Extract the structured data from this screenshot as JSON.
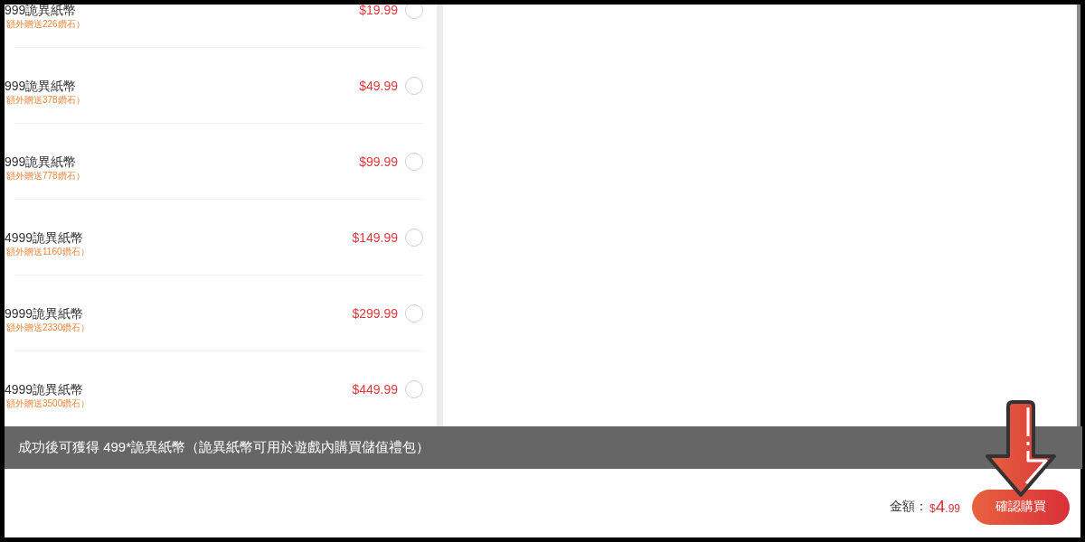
{
  "packages": [
    {
      "title": "999詭異紙幣",
      "bonus": "額外贈送226鑽石）",
      "price": "$19.99",
      "selected": false
    },
    {
      "title": "999詭異紙幣",
      "bonus": "額外贈送378鑽石）",
      "price": "$49.99",
      "selected": false
    },
    {
      "title": "999詭異紙幣",
      "bonus": "額外贈送778鑽石）",
      "price": "$99.99",
      "selected": false
    },
    {
      "title": "4999詭異紙幣",
      "bonus": "額外贈送1160鑽石）",
      "price": "$149.99",
      "selected": false
    },
    {
      "title": "9999詭異紙幣",
      "bonus": "額外贈送2330鑽石）",
      "price": "$299.99",
      "selected": false
    },
    {
      "title": "4999詭異紙幣",
      "bonus": "額外贈送3500鑽石）",
      "price": "$449.99",
      "selected": false
    }
  ],
  "notice": "成功後可獲得 499*詭異紙幣（詭異紙幣可用於遊戲內購買儲值禮包）",
  "footer": {
    "total_label": "金額：",
    "total": {
      "currency": "$",
      "whole": "4",
      "fraction": ".99"
    },
    "confirm_button": "確認購買"
  }
}
